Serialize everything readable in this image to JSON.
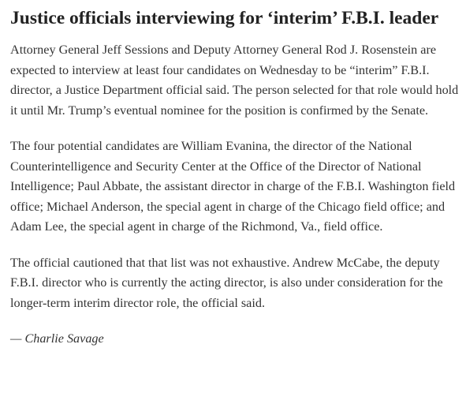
{
  "article": {
    "headline": "Justice officials interviewing for ‘interim’ F.B.I. leader",
    "paragraphs": [
      "Attorney General Jeff Sessions and Deputy Attorney General Rod J. Rosenstein are expected to interview at least four candidates on Wednesday to be “interim” F.B.I. director, a Justice Department official said. The person selected for that role would hold it until Mr. Trump’s eventual nominee for the position is confirmed by the Senate.",
      "The four potential candidates are William Evanina, the director of the National Counterintelligence and Security Center at the Office of the Director of National Intelligence; Paul Abbate, the assistant director in charge of the F.B.I. Washington field office; Michael Anderson, the special agent in charge of the Chicago field office; and Adam Lee, the special agent in charge of the Richmond, Va., field office.",
      "The official cautioned that that list was not exhaustive. Andrew McCabe, the deputy F.B.I. director who is currently the acting director, is also under consideration for the longer-term interim director role, the official said."
    ],
    "byline": "— Charlie Savage"
  },
  "colors": {
    "background": "#ffffff",
    "headline": "#222222",
    "body_text": "#333333"
  }
}
